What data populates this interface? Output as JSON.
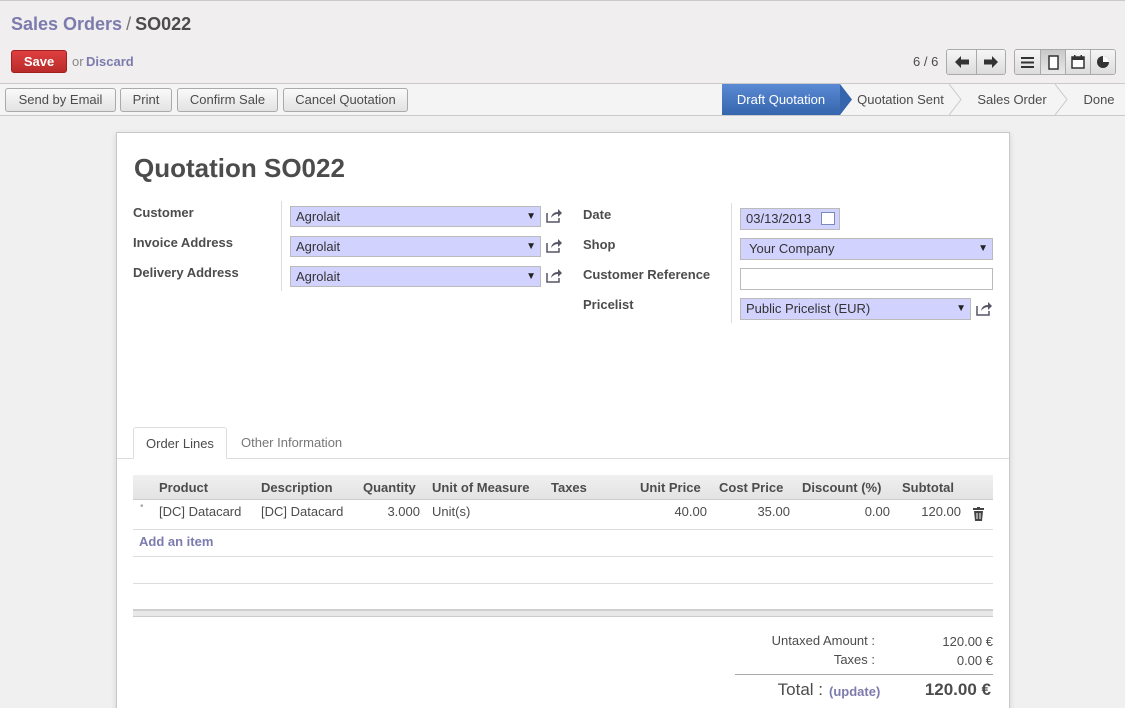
{
  "breadcrumb": {
    "parent": "Sales Orders",
    "separator": "/",
    "current": "SO022"
  },
  "header": {
    "save_label": "Save",
    "or_text": "or",
    "discard_label": "Discard",
    "pager": "6 / 6"
  },
  "icons": {
    "prev": "◀",
    "next": "▶",
    "list": "☰",
    "form": "▯",
    "calendar": "▦",
    "graph": "◕"
  },
  "actions": {
    "send_email": "Send by Email",
    "print": "Print",
    "confirm_sale": "Confirm Sale",
    "cancel_quotation": "Cancel Quotation"
  },
  "status": {
    "steps": [
      "Draft Quotation",
      "Quotation Sent",
      "Sales Order",
      "Done"
    ],
    "active_index": 0
  },
  "form": {
    "title": "Quotation SO022",
    "customer_label": "Customer",
    "customer_value": "Agrolait",
    "invoice_label": "Invoice Address",
    "invoice_value": "Agrolait",
    "delivery_label": "Delivery Address",
    "delivery_value": "Agrolait",
    "date_label": "Date",
    "date_value": "03/13/2013",
    "shop_label": "Shop",
    "shop_value": "Your Company",
    "customer_ref_label": "Customer Reference",
    "customer_ref_value": "",
    "pricelist_label": "Pricelist",
    "pricelist_value": "Public Pricelist (EUR)"
  },
  "tabs": [
    "Order Lines",
    "Other Information"
  ],
  "table": {
    "headers": [
      "Product",
      "Description",
      "Quantity",
      "Unit of Measure",
      "Taxes",
      "Unit Price",
      "Cost Price",
      "Discount (%)",
      "Subtotal"
    ],
    "rows": [
      {
        "product": "[DC] Datacard",
        "description": "[DC] Datacard",
        "quantity": "3.000",
        "uom": "Unit(s)",
        "taxes": "",
        "unit_price": "40.00",
        "cost_price": "35.00",
        "discount": "0.00",
        "subtotal": "120.00"
      }
    ],
    "add_item": "Add an item"
  },
  "totals": {
    "untaxed_label": "Untaxed Amount :",
    "untaxed_value": "120.00 €",
    "taxes_label": "Taxes :",
    "taxes_value": "0.00 €",
    "total_label": "Total :",
    "update_label": "(update)",
    "total_value": "120.00 €"
  },
  "colors": {
    "accent": "#7c7bad",
    "save": "#c83232",
    "status_active": "#3f6db2",
    "input_required": "#d2d2ff"
  }
}
